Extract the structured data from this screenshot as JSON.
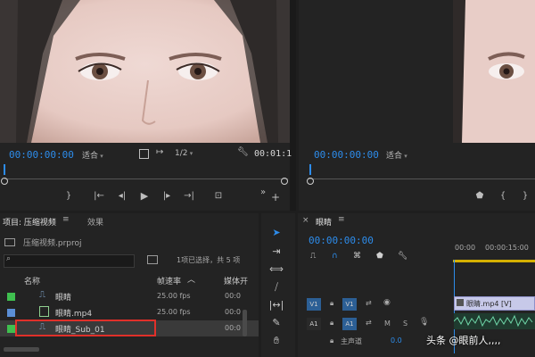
{
  "source_monitor": {
    "timecode": "00:00:00:00",
    "fit": "适合",
    "resolution": "1/2",
    "end_timecode": "00:01:1"
  },
  "program_monitor": {
    "timecode": "00:00:00:00",
    "fit": "适合"
  },
  "project_panel": {
    "tab_project": "项目: 压缩视频",
    "tab_effects": "效果",
    "project_file": "压缩视频.prproj",
    "selection_info": "1项已选择，共 5 项",
    "columns": {
      "name": "名称",
      "framerate": "帧速率",
      "media": "媒体开"
    },
    "items": [
      {
        "color": "#3fbf4f",
        "icon": "sequence-icon",
        "name": "眼睛",
        "fps": "25.00 fps",
        "media": "00:0"
      },
      {
        "color": "#5b8fd6",
        "icon": "video-clip-icon",
        "name": "眼睛.mp4",
        "fps": "25.00 fps",
        "media": "00:0"
      },
      {
        "color": "#3fbf4f",
        "icon": "sequence-icon",
        "name": "眼睛_Sub_01",
        "fps": "25.00 fps",
        "media": "00:0"
      }
    ]
  },
  "timeline": {
    "tab": "眼睛",
    "timecode": "00:00:00:00",
    "ruler": [
      "00:00",
      "00:00:15:00"
    ],
    "tracks": {
      "v1_source": "V1",
      "v1": "V1",
      "a1_source": "A1",
      "a1": "A1",
      "m": "M",
      "s": "S",
      "master": "主声道",
      "master_value": "0.0"
    },
    "clip_video": "眼睛.mp4 [V]"
  },
  "watermark": "头条 @眼前人,,,,",
  "colors": {
    "timecode_blue": "#2d8ceb",
    "selection_red": "#e0302a"
  }
}
